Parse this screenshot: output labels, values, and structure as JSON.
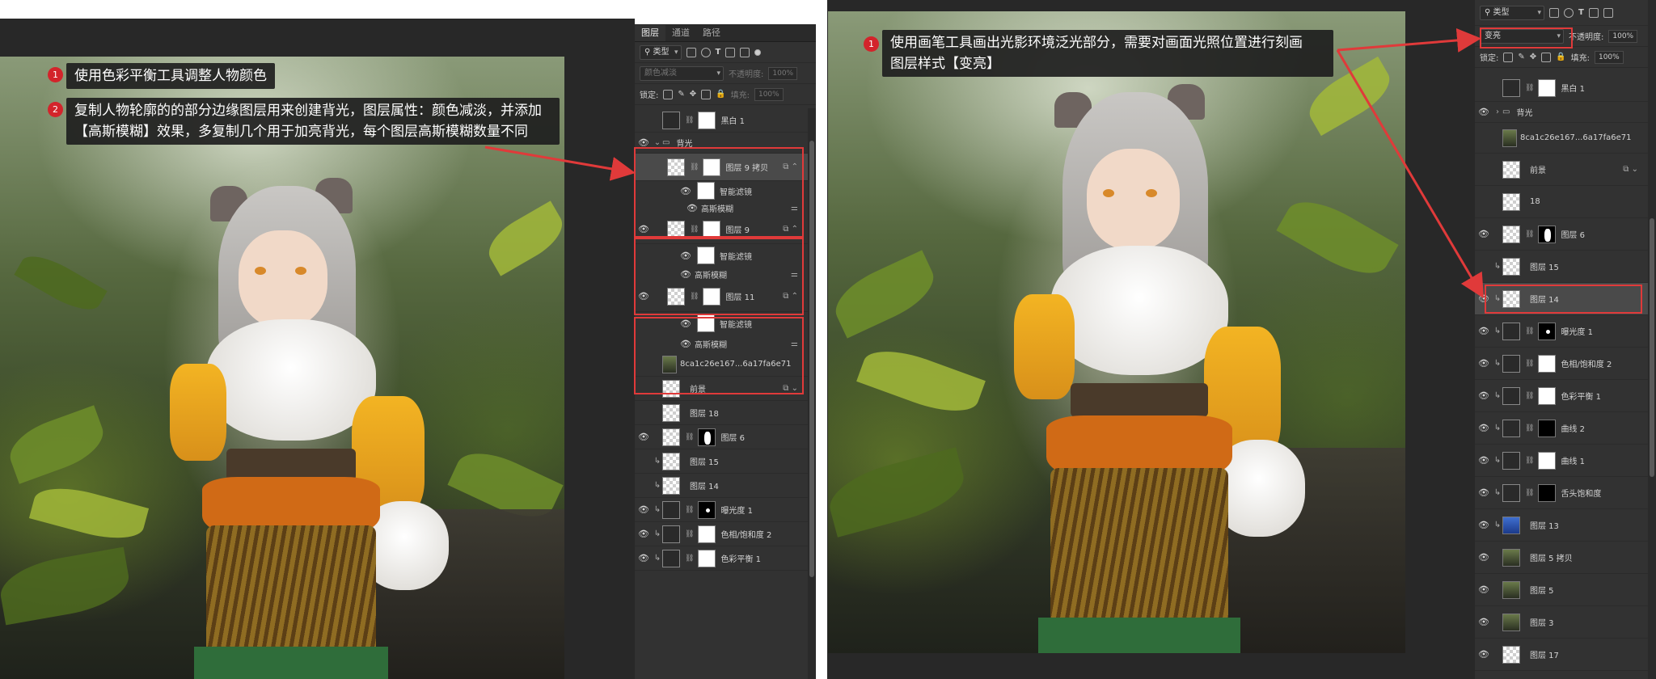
{
  "left": {
    "callouts": [
      {
        "num": "1",
        "text": "使用色彩平衡工具调整人物颜色"
      },
      {
        "num": "2",
        "text_line1": "复制人物轮廓的的部分边缘图层用来创建背光，图层属性：颜色减淡，并添加",
        "text_line2": "【高斯模糊】效果，多复制几个用于加亮背光，每个图层高斯模糊数量不同"
      }
    ],
    "panel": {
      "tabs": [
        "图层",
        "通道",
        "路径"
      ],
      "filter_kind": "类型",
      "blend_mode": "颜色减淡",
      "opacity_label": "不透明度:",
      "opacity_value": "100%",
      "lock_label": "锁定:",
      "fill_label": "填充:",
      "fill_value": "100%",
      "layers": [
        {
          "name": "黑白 1",
          "eye": false
        },
        {
          "name": "背光",
          "eye": true
        },
        {
          "name": "图层 9 拷贝",
          "eye": false
        },
        {
          "name": "智能滤镜"
        },
        {
          "name": "高斯模糊"
        },
        {
          "name": "图层 9",
          "eye": true
        },
        {
          "name": "智能滤镜"
        },
        {
          "name": "高斯模糊"
        },
        {
          "name": "图层 11",
          "eye": true
        },
        {
          "name": "智能滤镜"
        },
        {
          "name": "高斯模糊"
        },
        {
          "name": "8ca1c26e167...6a17fa6e71",
          "eye": false
        },
        {
          "name": "前景",
          "eye": false
        },
        {
          "name": "图层 18",
          "eye": false
        },
        {
          "name": "图层 6",
          "eye": true
        },
        {
          "name": "图层 15",
          "eye": false
        },
        {
          "name": "图层 14",
          "eye": false
        },
        {
          "name": "曝光度 1",
          "eye": true
        },
        {
          "name": "色相/饱和度 2",
          "eye": true
        },
        {
          "name": "色彩平衡 1",
          "eye": true
        }
      ]
    }
  },
  "right": {
    "callouts": [
      {
        "num": "1",
        "text_line1": "使用画笔工具画出光影环境泛光部分，需要对画面光照位置进行刻画",
        "text_line2": "图层样式【变亮】"
      }
    ],
    "panel": {
      "filter_kind": "类型",
      "blend_mode": "变亮",
      "opacity_label": "不透明度:",
      "opacity_value": "100%",
      "lock_label": "锁定:",
      "fill_label": "填充:",
      "fill_value": "100%",
      "layers": [
        {
          "name": "黑白 1",
          "eye": false
        },
        {
          "name": "背光",
          "eye": true
        },
        {
          "name": "8ca1c26e167...6a17fa6e71",
          "eye": false
        },
        {
          "name": "前景",
          "eye": false
        },
        {
          "name": "18",
          "eye": false
        },
        {
          "name": "图层 6",
          "eye": true
        },
        {
          "name": "图层 15",
          "eye": false
        },
        {
          "name": "图层 14",
          "eye": true
        },
        {
          "name": "曝光度 1",
          "eye": true
        },
        {
          "name": "色相/饱和度 2",
          "eye": true
        },
        {
          "name": "色彩平衡 1",
          "eye": true
        },
        {
          "name": "曲线 2",
          "eye": true
        },
        {
          "name": "曲线 1",
          "eye": true
        },
        {
          "name": "舌头饱和度",
          "eye": true
        },
        {
          "name": "图层 13",
          "eye": true
        },
        {
          "name": "图层 5 拷贝",
          "eye": true
        },
        {
          "name": "图层 5",
          "eye": true
        },
        {
          "name": "图层 3",
          "eye": true
        },
        {
          "name": "图层 17",
          "eye": true
        }
      ]
    }
  },
  "colors": {
    "panel_bg": "#323232",
    "highlight_red": "#e03a3a",
    "callout_badge": "#d3242b"
  }
}
